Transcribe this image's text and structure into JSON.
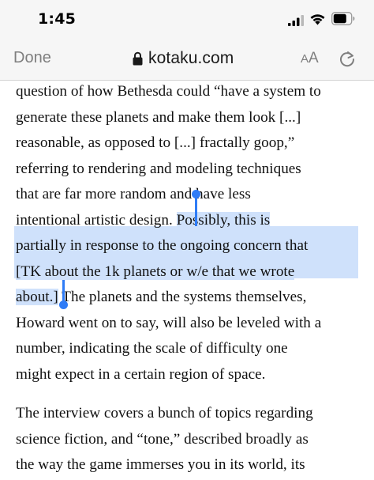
{
  "status_bar": {
    "time": "1:45",
    "signal_icon": "cellular-signal-icon",
    "wifi_icon": "wifi-icon",
    "battery_icon": "battery-icon"
  },
  "toolbar": {
    "done_label": "Done",
    "url": "kotaku.com",
    "lock_icon": "lock-icon",
    "text_size_small": "A",
    "text_size_large": "A",
    "reload_icon": "reload-icon"
  },
  "article": {
    "paragraph1": {
      "line1": "question of how Bethesda could “have a system to",
      "line2": "generate these planets and make them look [...]",
      "line3": "reasonable, as opposed to [...] fractally goop,”",
      "line4": "referring to rendering and modeling techniques",
      "line5": "that are far more random and have less",
      "line6_plain": "intentional artistic design. ",
      "line6_selected": "Possibly, this is",
      "line7_selected": "partially in response to the ongoing concern that",
      "line8_selected": "[TK about the 1k planets or w/e that we wrote",
      "line9_selected": "about.]",
      "line9_plain": " The planets and the systems themselves,",
      "line10": "Howard went on to say, will also be leveled with a",
      "line11": "number, indicating the scale of difficulty one",
      "line12": "might expect in a certain region of space."
    },
    "paragraph2": {
      "line1": "The interview covers a bunch of topics regarding",
      "line2": "science fiction, and “tone,” described broadly as",
      "line3": "the way the game immerses you in its world, its"
    }
  },
  "colors": {
    "selection": "#cfe1fb",
    "selection_handle": "#2f7cf6",
    "toolbar_bg": "#f6f6f6"
  }
}
